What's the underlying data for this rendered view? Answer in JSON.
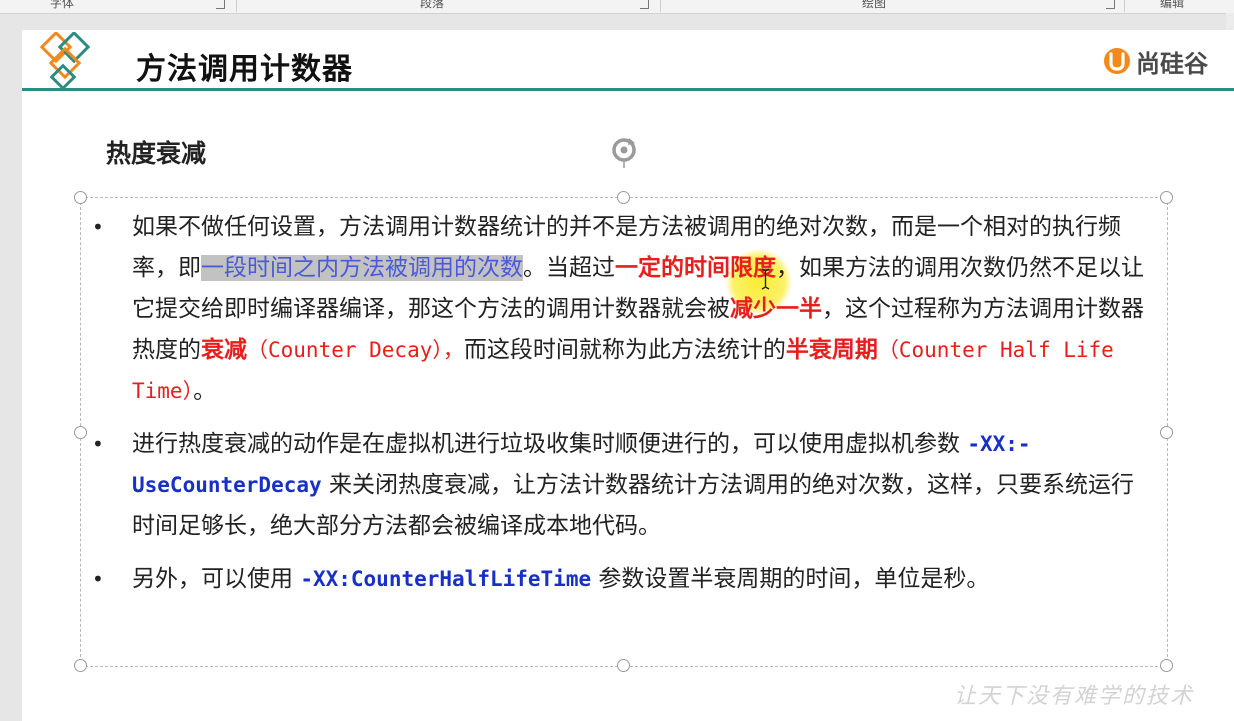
{
  "ribbon": {
    "groups": [
      "字体",
      "段落",
      "绘图",
      "编辑"
    ]
  },
  "slide": {
    "title": "方法调用计数器",
    "brand": "尚硅谷",
    "subtitle": "热度衰减",
    "bullets": [
      {
        "b1_t1": "如果不做任何设置，方法调用计数器统计的并不是方法被调用的绝对次数，而是一个相对的执行频率，即",
        "b1_highlight": "一段时间之内方法被调用的次数",
        "b1_t2": "。当超过",
        "b1_red1": "一定的时间限度",
        "b1_t3": "，如果方法的调用次数仍然不足以让它提交给即时编译器编译，那这个方法的调用计数器就会被",
        "b1_red2": "减少一半",
        "b1_t4": "，这个过程称为方法调用计数器热度的",
        "b1_red3": "衰减",
        "b1_red3_en": "（Counter Decay），",
        "b1_t5": "而这段时间就称为此方法统计的",
        "b1_red4": "半衰周期",
        "b1_red4_en": "（Counter Half Life Time）",
        "b1_t6": "。"
      },
      {
        "b2_t1": "进行热度衰减的动作是在虚拟机进行垃圾收集时顺便进行的，可以使用虚拟机参数 ",
        "b2_code": "-XX:-UseCounterDecay",
        "b2_t2": " 来关闭热度衰减，让方法计数器统计方法调用的绝对次数，这样，只要系统运行时间足够长，绝大部分方法都会被编译成本地代码。"
      },
      {
        "b3_t1": "另外，可以使用 ",
        "b3_code": "-XX:CounterHalfLifeTime",
        "b3_t2": " 参数设置半衰周期的时间，单位是秒。"
      }
    ],
    "bullet_glyph": "•",
    "watermark": "让天下没有难学的技术"
  },
  "colors": {
    "accent_teal": "#2e8b84",
    "logo_orange": "#f08a1c",
    "highlight_red": "#e81e1e",
    "code_blue": "#1830c8",
    "selection_bg": "#c2c2c2"
  },
  "icons": [
    "logo-diamond-icon",
    "rotate-handle-icon",
    "text-cursor-icon",
    "brand-u-icon"
  ]
}
